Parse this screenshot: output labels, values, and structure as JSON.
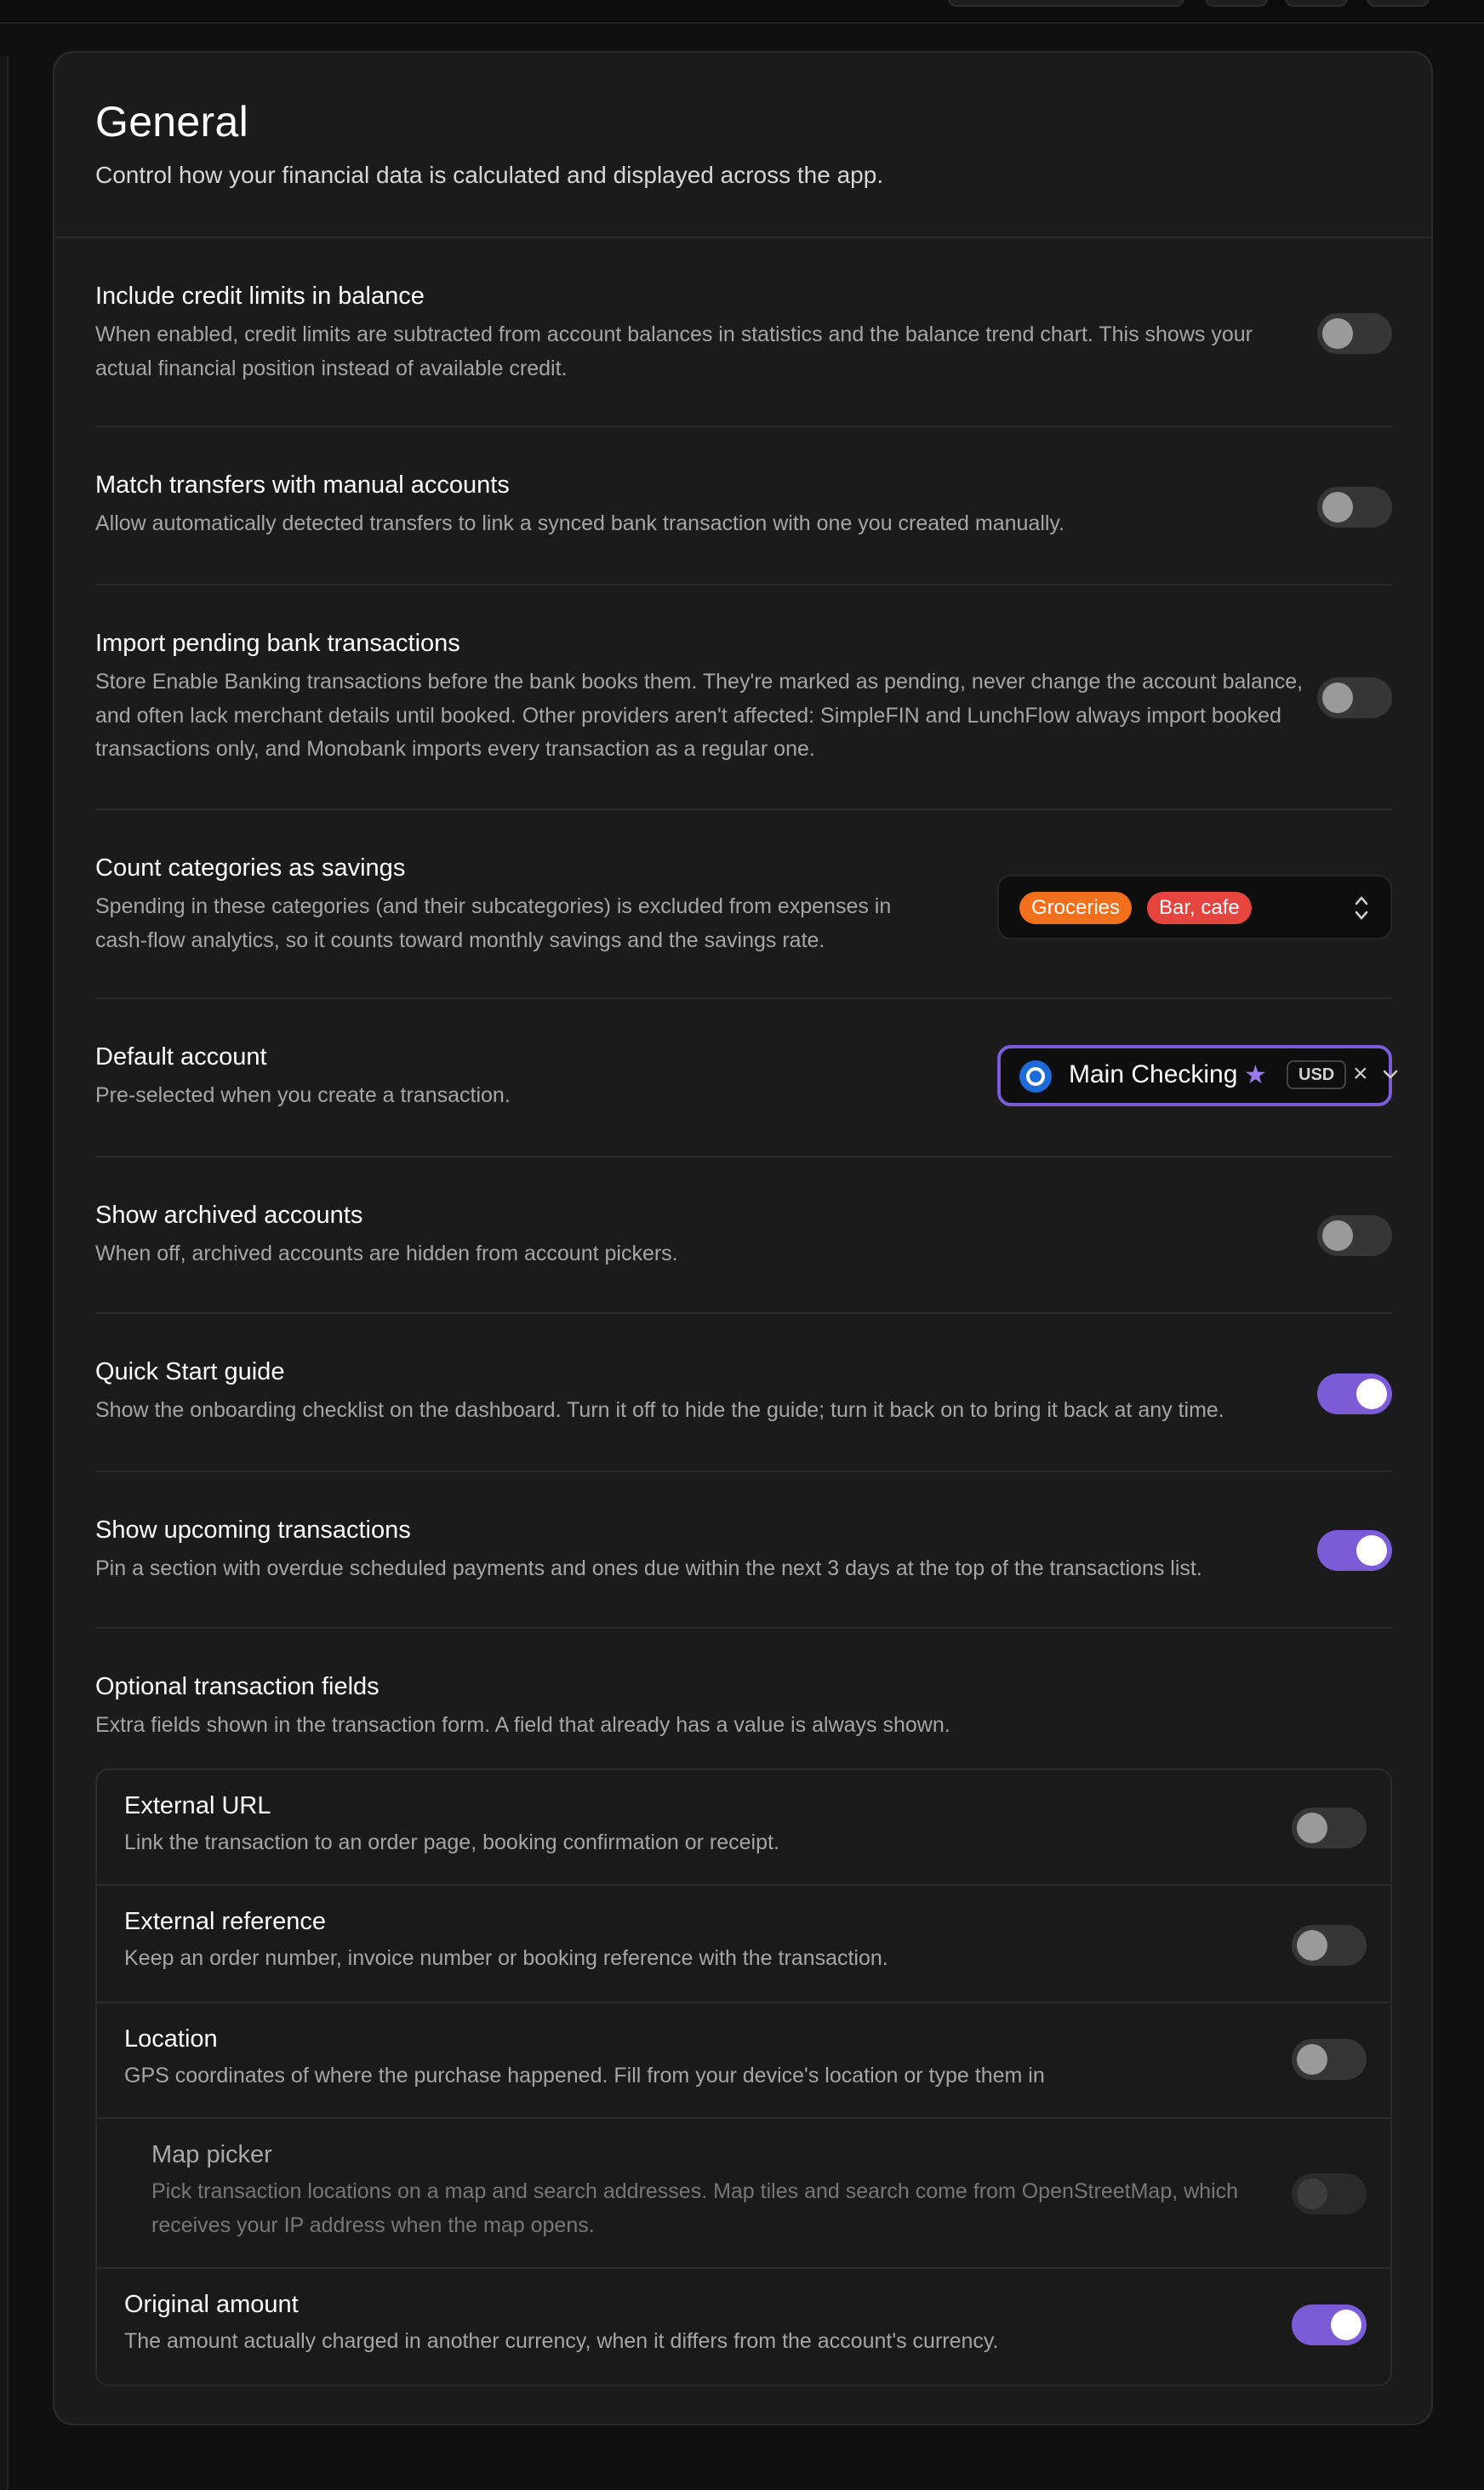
{
  "page": {
    "title": "General",
    "subtitle": "Control how your financial data is calculated and displayed across the app."
  },
  "settings": {
    "credit_limits": {
      "title": "Include credit limits in balance",
      "desc_line1": "When enabled, credit limits are subtracted from account balances in statistics and the balance trend chart. This shows your",
      "desc_line2": "actual financial position instead of available credit.",
      "enabled": false
    },
    "match_transfers": {
      "title": "Match transfers with manual accounts",
      "desc_line1": "Allow automatically detected transfers to link a synced bank transaction with one you created manually.",
      "enabled": false
    },
    "pending": {
      "title": "Import pending bank transactions",
      "desc_line1": "Store Enable Banking transactions before the bank books them. They're marked as pending, never change the account balance,",
      "desc_line2": "and often lack merchant details until booked. Other providers aren't affected: SimpleFIN and LunchFlow always import booked",
      "desc_line3": "transactions only, and Monobank imports every transaction as a regular one.",
      "enabled": false
    },
    "savings": {
      "title": "Count categories as savings",
      "desc_line1": "Spending in these categories (and their subcategories) is excluded from expenses in",
      "desc_line2": "cash-flow analytics, so it counts toward monthly savings and the savings rate.",
      "chips": [
        {
          "label": "Groceries",
          "color": "#f26f1c"
        },
        {
          "label": "Bar, cafe",
          "color": "#e5443f"
        }
      ]
    },
    "default_account": {
      "title": "Default account",
      "desc_line1": "Pre-selected when you create a transaction.",
      "account_name": "Main Checking",
      "currency": "USD",
      "favorite_icon": "star-icon",
      "clear_icon": "close-icon",
      "open_icon": "chevron-down-icon"
    },
    "archived": {
      "title": "Show archived accounts",
      "desc_line1": "When off, archived accounts are hidden from account pickers.",
      "enabled": false
    },
    "quick_start": {
      "title": "Quick Start guide",
      "desc_line1": "Show the onboarding checklist on the dashboard. Turn it off to hide the guide; turn it back on to bring it back at any time.",
      "enabled": true
    },
    "upcoming": {
      "title": "Show upcoming transactions",
      "desc_line1": "Pin a section with overdue scheduled payments and ones due within the next 3 days at the top of the transactions list.",
      "enabled": true
    },
    "optional_fields": {
      "title": "Optional transaction fields",
      "desc_line1": "Extra fields shown in the transaction form. A field that already has a value is always shown.",
      "fields": {
        "external_url": {
          "title": "External URL",
          "desc_line1": "Link the transaction to an order page, booking confirmation or receipt.",
          "enabled": false
        },
        "external_ref": {
          "title": "External reference",
          "desc_line1": "Keep an order number, invoice number or booking reference with the transaction.",
          "enabled": false
        },
        "location": {
          "title": "Location",
          "desc_line1": "GPS coordinates of where the purchase happened. Fill from your device's location or type them in",
          "enabled": false
        },
        "map_picker": {
          "title": "Map picker",
          "desc_line1": "Pick transaction locations on a map and search addresses. Map tiles and search come from OpenStreetMap, which",
          "desc_line2": "receives your IP address when the map opens.",
          "enabled": false,
          "disabled": true
        },
        "original_amount": {
          "title": "Original amount",
          "desc_line1": "The amount actually charged in another currency, when it differs from the account's currency.",
          "enabled": true
        }
      }
    }
  },
  "colors": {
    "accent": "#7c5cd6",
    "background": "#101010",
    "card": "#1b1b1b"
  }
}
